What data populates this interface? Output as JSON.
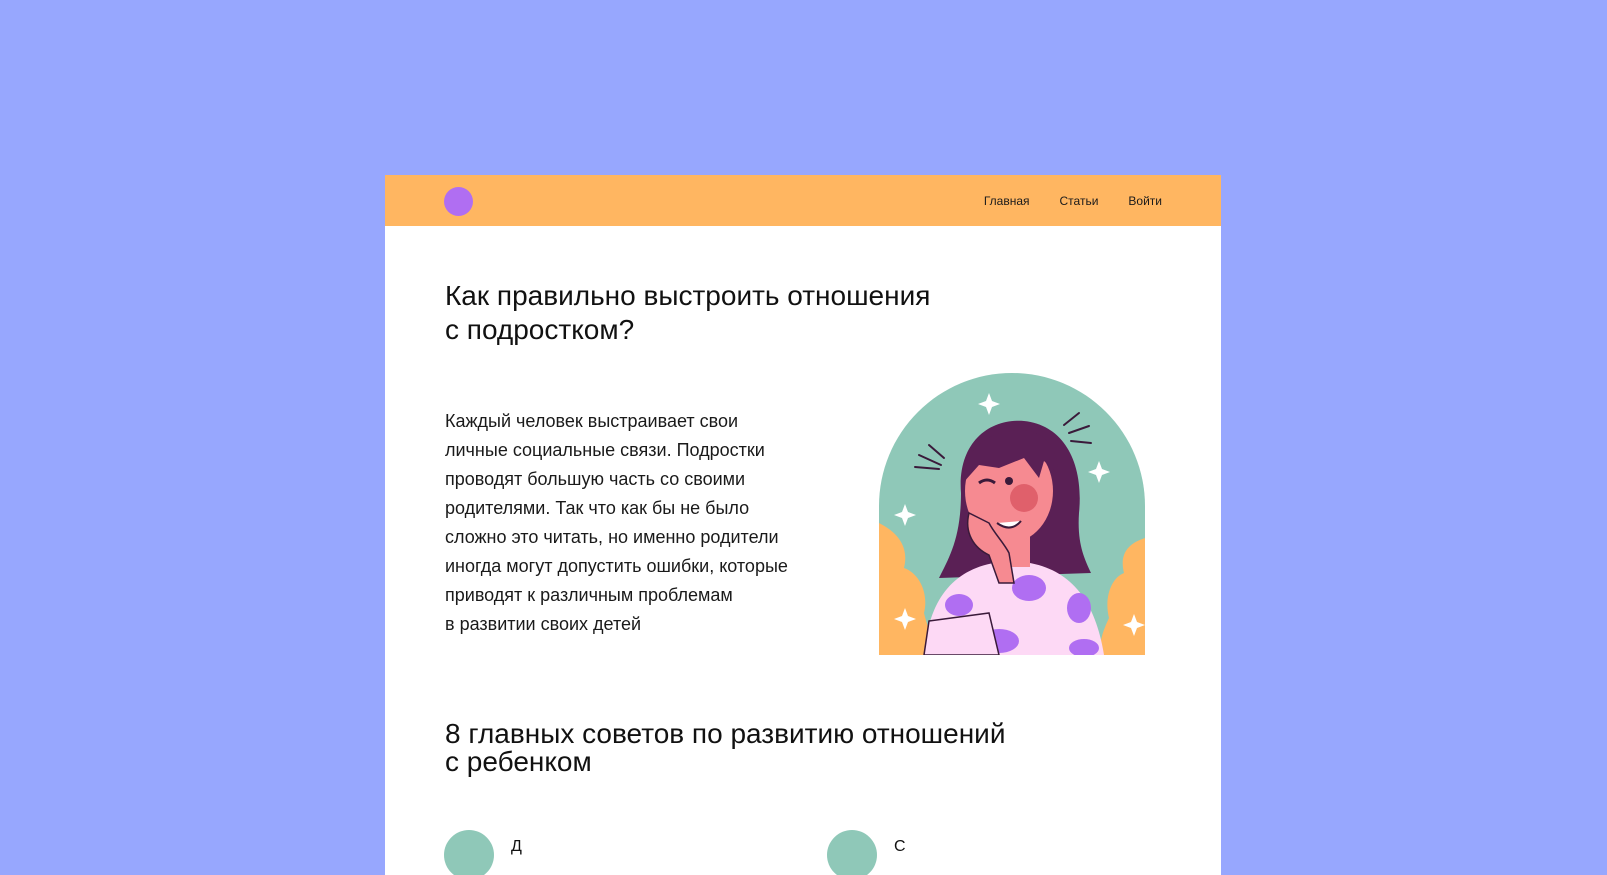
{
  "header": {
    "nav": [
      {
        "label": "Главная"
      },
      {
        "label": "Статьи"
      },
      {
        "label": "Войти"
      }
    ]
  },
  "article": {
    "title": "Как правильно выстроить отношения\nс подростком?",
    "intro": "Каждый человек выстраивает свои\nличные социальные связи. Подростки\nпроводят большую часть со своими\nродителями. Так что как бы не было\nсложно это читать, но именно родители\nиногда могут допустить ошибки, которые\nприводят к различным проблемам\nв развитии своих детей",
    "subtitle": "8 главных советов по развитию отношений\nс ребенком",
    "tips": [
      {
        "label": "Д"
      },
      {
        "label": "С"
      }
    ]
  },
  "colors": {
    "page_bg": "#97a7fe",
    "header_bg": "#ffb661",
    "logo": "#b06ef2",
    "illustration_arch": "#8fc8b8",
    "illustration_bush": "#ffb661",
    "hair": "#5a2055",
    "skin": "#f68a91",
    "shirt": "#fdd9f5",
    "shirt_spots": "#b06ef2"
  }
}
